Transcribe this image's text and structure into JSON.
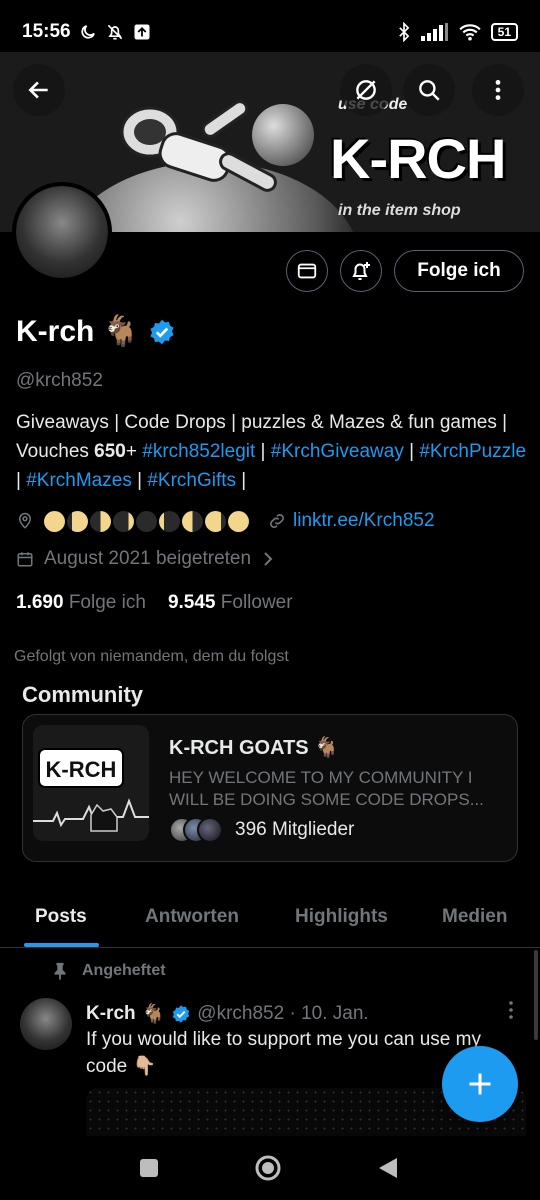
{
  "status_bar": {
    "time": "15:56",
    "battery": "51",
    "icons": [
      "moon-icon",
      "mute-icon",
      "upload-icon",
      "bluetooth-icon",
      "signal-icon",
      "wifi-icon"
    ]
  },
  "banner": {
    "promo_line1": "use code",
    "promo_line2": "K-RCH",
    "promo_line3": "in the item shop"
  },
  "header_buttons": [
    "back-arrow-icon",
    "grok-icon",
    "search-icon",
    "more-vertical-icon"
  ],
  "profile": {
    "follow_label": "Folge ich",
    "name": "K-rch",
    "name_emoji": "🐐",
    "handle": "@krch852",
    "bio_plain1": "Giveaways | Code Drops | puzzles & Mazes & fun games | Vouches 𝟔𝟓𝟎+ ",
    "bio_tags": [
      "#krch852legit",
      "#KrchGiveaway",
      "#KrchPuzzle",
      "#KrchMazes",
      "#KrchGifts"
    ],
    "bio_sep": " | ",
    "bio_end": " |",
    "location_moons": "🌕🌖🌗🌘🌑🌒🌓🌔🌕",
    "link": "linktr.ee/Krch852",
    "joined": "August 2021 beigetreten",
    "following_count": "1.690",
    "following_label": "Folge ich",
    "followers_count": "9.545",
    "followers_label": "Follower",
    "followed_by": "Gefolgt von niemandem, dem du folgst"
  },
  "community": {
    "heading": "Community",
    "image_text": "K-RCH",
    "title": "K-RCH GOATS 🐐",
    "description": "HEY WELCOME TO MY COMMUNITY I WILL BE DOING SOME CODE DROPS...",
    "members": "396 Mitglieder"
  },
  "tabs": [
    {
      "label": "Posts",
      "active": true
    },
    {
      "label": "Antworten",
      "active": false
    },
    {
      "label": "Highlights",
      "active": false
    },
    {
      "label": "Medien",
      "active": false
    }
  ],
  "post": {
    "pinned_label": "Angeheftet",
    "author": "K-rch",
    "author_emoji": "🐐",
    "handle_date": "@krch852 · 10. Jan.",
    "text": "If you would like to support me you can use my code 👇🏼"
  },
  "colors": {
    "accent": "#1d9bf0",
    "background": "#000000",
    "muted_text": "#71767b",
    "text": "#e7e9ea"
  }
}
